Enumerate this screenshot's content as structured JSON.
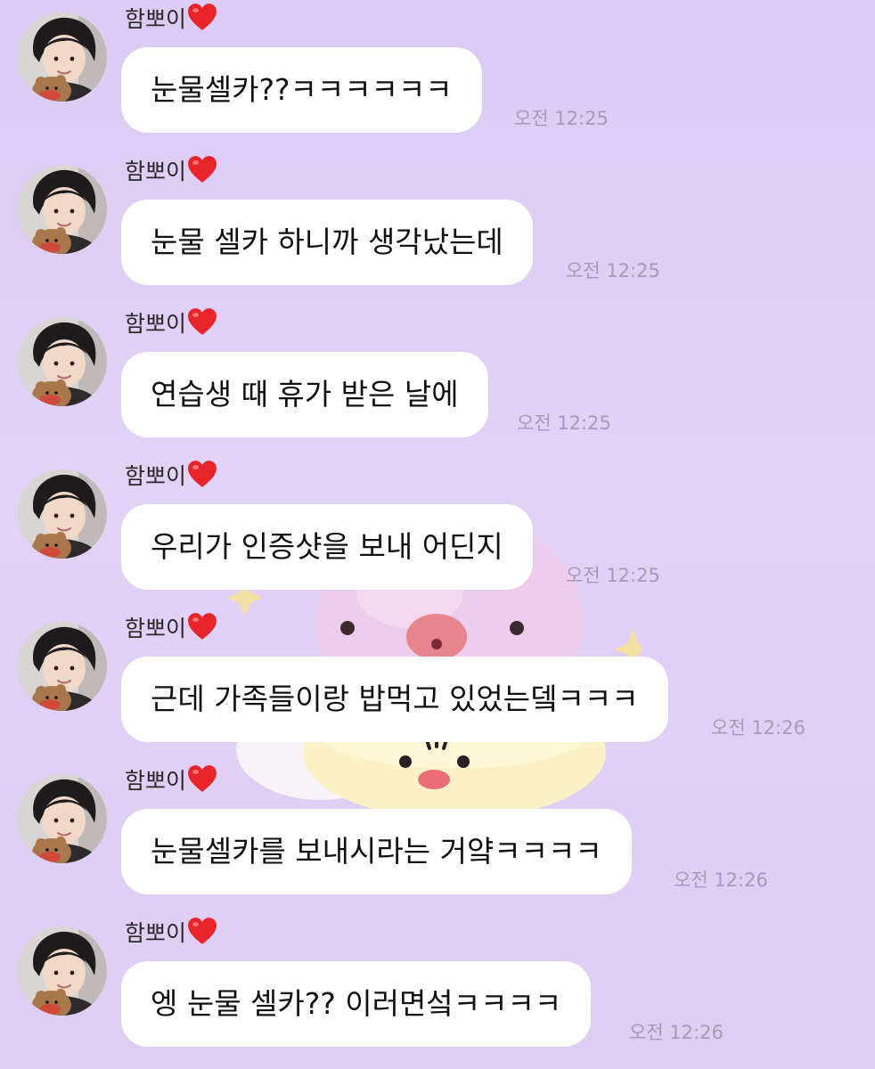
{
  "messages": [
    {
      "sender": "함뽀이",
      "text": "눈물셀카??ㅋㅋㅋㅋㅋㅋ",
      "time": "오전 12:25"
    },
    {
      "sender": "함뽀이",
      "text": "눈물 셀카 하니까 생각났는데",
      "time": "오전 12:25"
    },
    {
      "sender": "함뽀이",
      "text": "연습생 때 휴가 받은 날에",
      "time": "오전 12:25"
    },
    {
      "sender": "함뽀이",
      "text": "우리가 인증샷을 보내 어딘지",
      "time": "오전 12:25"
    },
    {
      "sender": "함뽀이",
      "text": "근데 가족들이랑 밥먹고 있었는뎈ㅋㅋㅋ",
      "time": "오전 12:26"
    },
    {
      "sender": "함뽀이",
      "text": "눈물셀카를 보내시라는 거얔ㅋㅋㅋㅋ",
      "time": "오전 12:26"
    },
    {
      "sender": "함뽀이",
      "text": "엥 눈물 셀카?? 이러면섴ㅋㅋㅋㅋ",
      "time": "오전 12:26"
    }
  ],
  "icons": {
    "sender_badge": "red-heart-icon",
    "avatar": "profile-photo"
  },
  "colors": {
    "background": "#dccbf3",
    "bubble": "#ffffff",
    "time": "#a69bb4"
  }
}
